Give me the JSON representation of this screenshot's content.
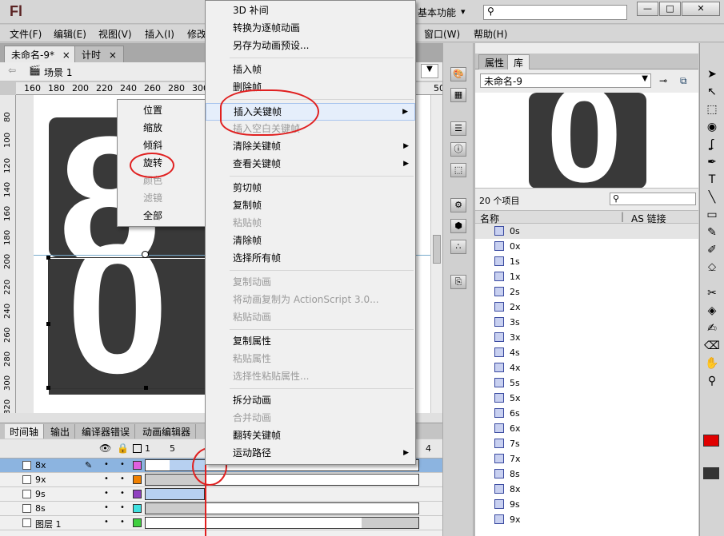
{
  "app": {
    "logo": "Fl",
    "workspace": "基本功能",
    "workspace_arrow": "▾",
    "search_value": "",
    "win_buttons": [
      "—",
      "□",
      "✕"
    ]
  },
  "menubar": [
    "文件(F)",
    "编辑(E)",
    "视图(V)",
    "插入(I)",
    "修改",
    "窗口(W)",
    "帮助(H)"
  ],
  "doc_tabs": [
    {
      "label": "未命名-9*",
      "close": "×"
    },
    {
      "label": "计时",
      "close": "×"
    }
  ],
  "scene": {
    "label": "场景 1"
  },
  "ruler_h": [
    "160",
    "180",
    "200",
    "220",
    "240",
    "260",
    "280",
    "300",
    "50"
  ],
  "ruler_v": [
    "80",
    "100",
    "120",
    "140",
    "160",
    "180",
    "200",
    "220",
    "240",
    "260",
    "280",
    "300",
    "320"
  ],
  "stage": {
    "card1_digit": "8",
    "card2_digit": "0"
  },
  "context_menu": {
    "items": [
      {
        "label": "3D 补间",
        "disabled": false
      },
      {
        "label": "转换为逐帧动画",
        "disabled": false
      },
      {
        "label": "另存为动画预设...",
        "disabled": false
      },
      {
        "sep": true
      },
      {
        "label": "插入帧",
        "disabled": false
      },
      {
        "label": "删除帧",
        "disabled": false
      },
      {
        "sep": true
      },
      {
        "label": "插入关键帧",
        "disabled": false,
        "submenu": true,
        "highlight": true
      },
      {
        "label": "插入空白关键帧",
        "disabled": true
      },
      {
        "label": "清除关键帧",
        "disabled": false,
        "submenu": true
      },
      {
        "label": "查看关键帧",
        "disabled": false,
        "submenu": true
      },
      {
        "sep": true
      },
      {
        "label": "剪切帧",
        "disabled": false
      },
      {
        "label": "复制帧",
        "disabled": false
      },
      {
        "label": "粘贴帧",
        "disabled": true
      },
      {
        "label": "清除帧",
        "disabled": false
      },
      {
        "label": "选择所有帧",
        "disabled": false
      },
      {
        "sep": true
      },
      {
        "label": "复制动画",
        "disabled": true
      },
      {
        "label": "将动画复制为 ActionScript 3.0...",
        "disabled": true
      },
      {
        "label": "粘贴动画",
        "disabled": true
      },
      {
        "sep": true
      },
      {
        "label": "复制属性",
        "disabled": false
      },
      {
        "label": "粘贴属性",
        "disabled": true
      },
      {
        "label": "选择性粘贴属性...",
        "disabled": true
      },
      {
        "sep": true
      },
      {
        "label": "拆分动画",
        "disabled": false
      },
      {
        "label": "合并动画",
        "disabled": true
      },
      {
        "label": "翻转关键帧",
        "disabled": false
      },
      {
        "label": "运动路径",
        "disabled": false,
        "submenu": true
      }
    ]
  },
  "submenu": {
    "items": [
      {
        "label": "位置",
        "disabled": false
      },
      {
        "label": "缩放",
        "disabled": false
      },
      {
        "label": "倾斜",
        "disabled": false
      },
      {
        "label": "旋转",
        "disabled": false
      },
      {
        "label": "颜色",
        "disabled": true
      },
      {
        "label": "滤镜",
        "disabled": true
      },
      {
        "label": "全部",
        "disabled": false
      }
    ]
  },
  "timeline": {
    "tabs": [
      "时间轴",
      "输出",
      "编译器错误",
      "动画编辑器"
    ],
    "frame_numbers": [
      "1",
      "5",
      "4"
    ],
    "layers": [
      {
        "name": "8x",
        "color": "#e060e0",
        "selected": true
      },
      {
        "name": "9x",
        "color": "#f08000",
        "selected": false
      },
      {
        "name": "9s",
        "color": "#9040c0",
        "selected": false
      },
      {
        "name": "8s",
        "color": "#40e0e0",
        "selected": false
      },
      {
        "name": "图层 1",
        "color": "#40d040",
        "selected": false
      }
    ]
  },
  "library": {
    "tabs": [
      "属性",
      "库"
    ],
    "doc_select": "未命名-9",
    "count": "20 个项目",
    "search_value": "",
    "col_name": "名称",
    "col_link": "AS 链接",
    "items": [
      "0s",
      "0x",
      "1s",
      "1x",
      "2s",
      "2x",
      "3s",
      "3x",
      "4s",
      "4x",
      "5s",
      "5x",
      "6s",
      "6x",
      "7s",
      "7x",
      "8s",
      "8x",
      "9s",
      "9x"
    ],
    "preview_digit": "0"
  },
  "toolbox": {
    "tools": [
      "➤",
      "↖",
      "⬚",
      "◉",
      "ʆ",
      "✒",
      "T",
      "╲",
      "▭",
      "✎",
      "✐",
      "⎐",
      "✂",
      "◈",
      "✍",
      "⌫",
      "✋",
      "⚲"
    ],
    "colors": {
      "stroke": "#e00000",
      "fill": "#333333"
    }
  }
}
